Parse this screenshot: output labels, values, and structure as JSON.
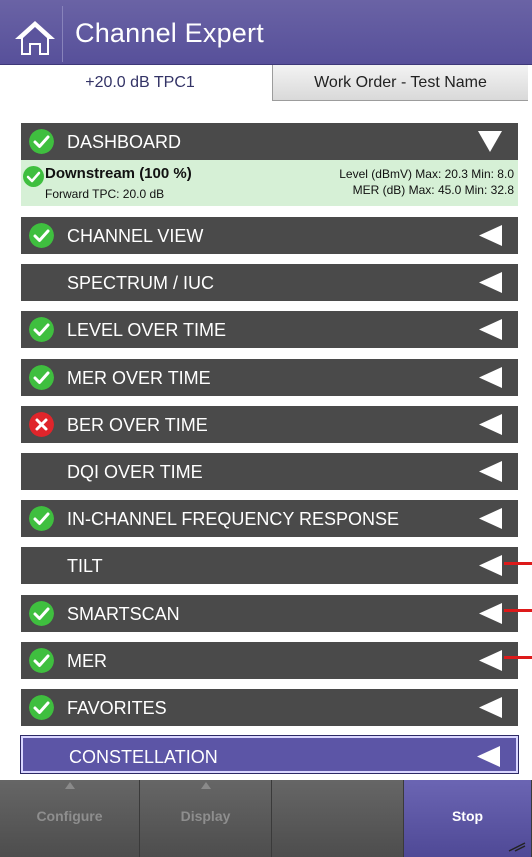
{
  "header": {
    "title": "Channel Expert",
    "home_icon": "home-icon",
    "color": "#5b549d"
  },
  "tabs": {
    "active_label": "+20.0 dB TPC1",
    "inactive_label": "Work Order - Test Name"
  },
  "dashboard": {
    "label": "DASHBOARD",
    "status": "pass",
    "expanded": true,
    "card": {
      "title": "Downstream (100 %)",
      "subtitle": "Forward TPC: 20.0 dB",
      "level_line": "Level (dBmV) Max: 20.3 Min: 8.0",
      "mer_line": "MER (dB) Max: 45.0 Min: 32.8",
      "bg_color": "#d6f0d6"
    }
  },
  "menu_items": [
    {
      "label": "CHANNEL VIEW",
      "status": "pass"
    },
    {
      "label": "SPECTRUM / IUC",
      "status": "none"
    },
    {
      "label": "LEVEL OVER TIME",
      "status": "pass"
    },
    {
      "label": "MER OVER TIME",
      "status": "pass"
    },
    {
      "label": "BER OVER TIME",
      "status": "fail"
    },
    {
      "label": "DQI OVER TIME",
      "status": "none"
    },
    {
      "label": "IN-CHANNEL FREQUENCY RESPONSE",
      "status": "pass"
    },
    {
      "label": "TILT",
      "status": "none"
    },
    {
      "label": "SMARTSCAN",
      "status": "pass"
    },
    {
      "label": "MER",
      "status": "pass"
    },
    {
      "label": "FAVORITES",
      "status": "pass"
    },
    {
      "label": "CONSTELLATION",
      "status": "none",
      "selected": true
    }
  ],
  "colors": {
    "pass": "#3fbf3f",
    "fail": "#e0252b",
    "row_bg": "#4a4a4a",
    "selected_bg": "#5c55a6",
    "marker": "#dd1a1a"
  },
  "footer": {
    "buttons": [
      {
        "label": "Configure",
        "enabled": false
      },
      {
        "label": "Display",
        "enabled": false
      },
      {
        "label": "",
        "enabled": false
      },
      {
        "label": "Stop",
        "enabled": true
      }
    ]
  }
}
